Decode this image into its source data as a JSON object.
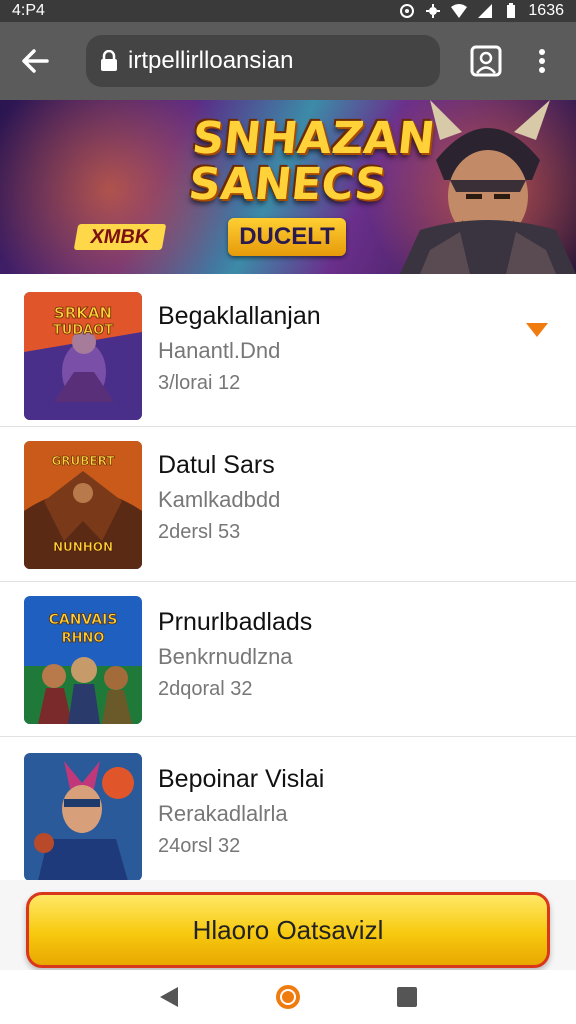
{
  "status_bar": {
    "time": "4:P4",
    "clock_right": "1636"
  },
  "browser": {
    "url": "irtpellirlloansian"
  },
  "banner": {
    "title_line1": "SNHAZAN",
    "title_line2": "SANECS",
    "tag": "XMBK",
    "subtitle": "DUCELT"
  },
  "games": [
    {
      "title": "Begaklallanjan",
      "subtitle": "Hanantl.Dnd",
      "meta": "3/lorai 12",
      "thumb_text": "SRKAN TUDAOT"
    },
    {
      "title": "Datul Sars",
      "subtitle": "Kamlkadbdd",
      "meta": "2dersl 53",
      "thumb_text": "NUNHON"
    },
    {
      "title": "Prnurlbadlads",
      "subtitle": "Benkrnudlzna",
      "meta": "2dqoral 32",
      "thumb_text": "CANVAIS RHNO"
    },
    {
      "title": "Bepoinar Vislai",
      "subtitle": "Rerakadlalrla",
      "meta": "24orsl 32",
      "thumb_text": ""
    }
  ],
  "cta": {
    "label": "Hlaoro Oatsavizl"
  },
  "colors": {
    "accent": "#f7c90f",
    "cta_border": "#d9371b",
    "expand_arrow": "#f07c10",
    "app_bar": "#5b5b5b"
  },
  "icons": [
    "back-arrow-icon",
    "lock-icon",
    "tab-switcher-icon",
    "more-vert-icon",
    "expand-arrow-icon",
    "nav-back-icon",
    "nav-home-icon",
    "nav-recents-icon"
  ]
}
